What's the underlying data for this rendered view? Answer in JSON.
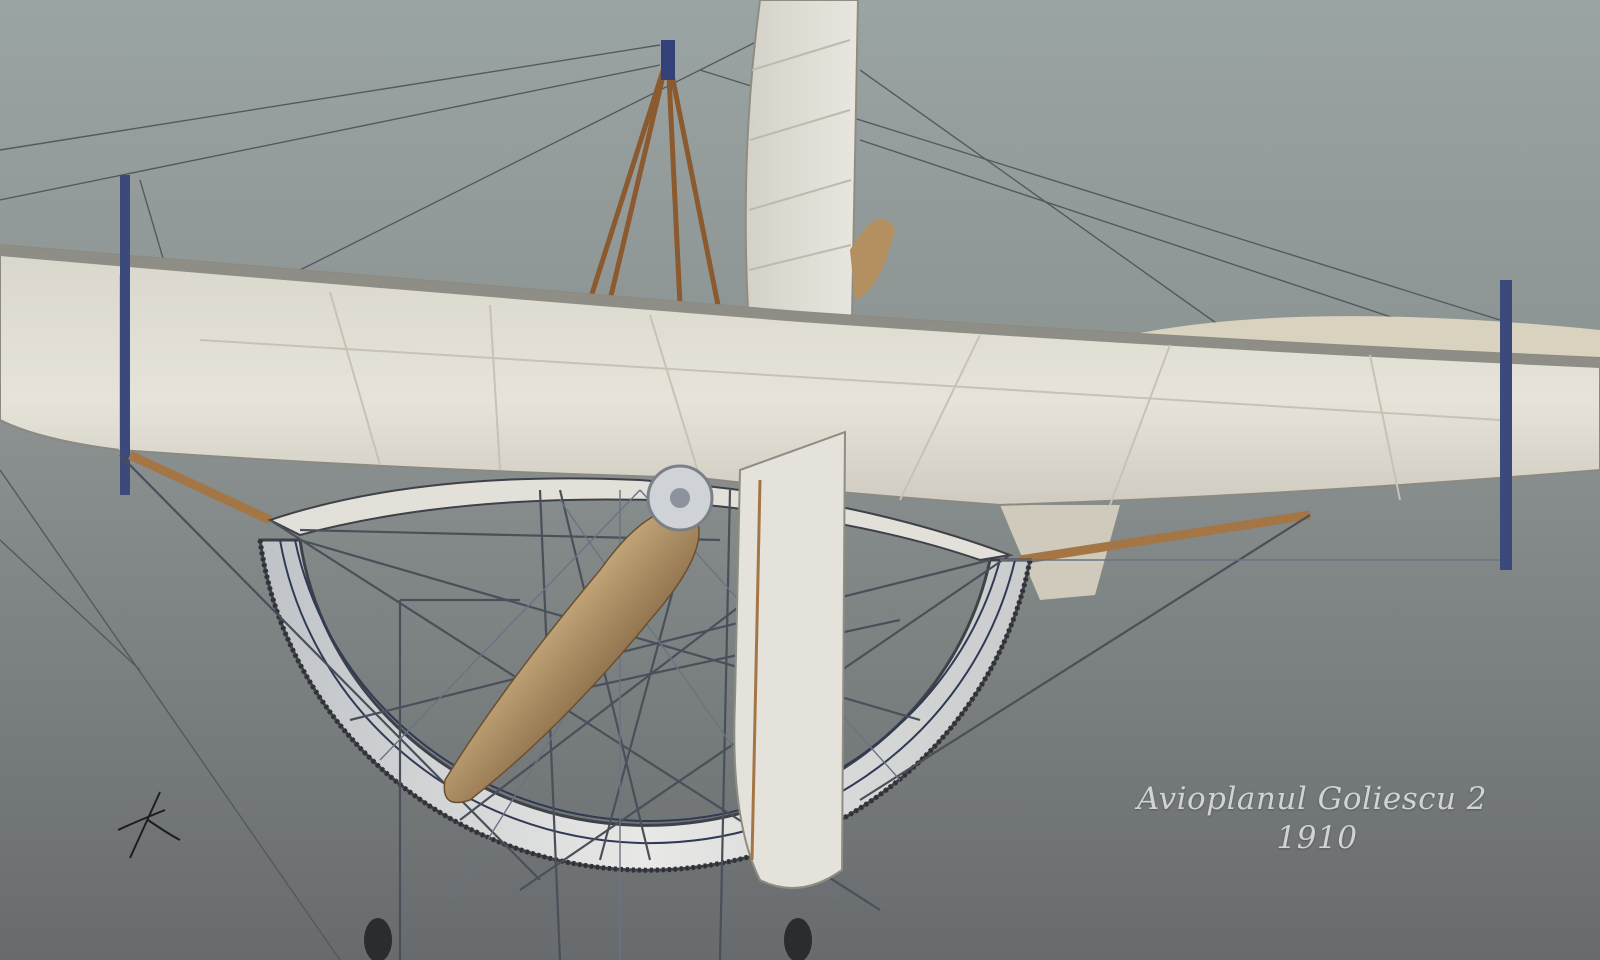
{
  "caption": {
    "title": "Avioplanul Goliescu 2",
    "year": "1910"
  },
  "palette": {
    "sky_top": "#98a2a1",
    "sky_bottom": "#6b6e70",
    "fabric": "#e4e1d7",
    "fabric_shadow": "#b9b5aa",
    "wood": "#a2703f",
    "steel": "#4a4f5a",
    "strut_blue": "#3c4b7a",
    "propeller": "#b49666"
  },
  "scene": {
    "subject": "airplane-render",
    "icons": [
      "signature-mark"
    ]
  }
}
